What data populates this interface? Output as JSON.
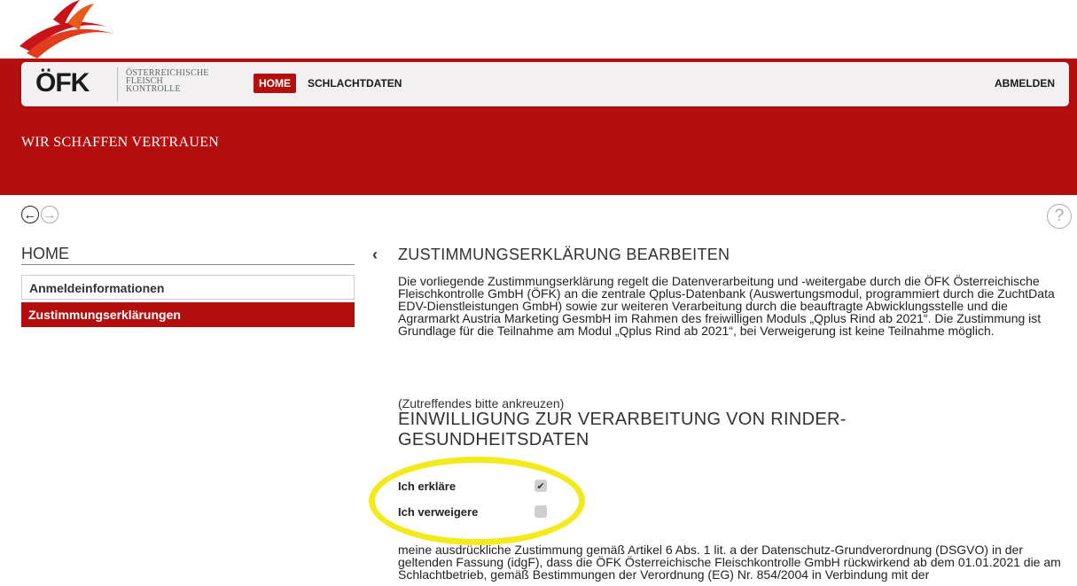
{
  "brand": {
    "logo_mark": "ÖFK",
    "subtitle_lines": [
      "ÖSTERREICHISCHE",
      "FLEISCH",
      "KONTROLLE"
    ],
    "slogan": "WIR SCHAFFEN VERTRAUEN",
    "color": "#b30f0f"
  },
  "nav": {
    "home": "HOME",
    "schlachtdaten": "SCHLACHTDATEN",
    "logout": "ABMELDEN"
  },
  "toolbar": {
    "back_icon": "arrow-left-icon",
    "forward_icon": "arrow-right-icon",
    "help_icon": "help-icon",
    "back_glyph": "←",
    "forward_glyph": "→",
    "help_glyph": "?"
  },
  "sidebar": {
    "title": "HOME",
    "items": [
      {
        "label": "Anmeldeinformationen",
        "active": false
      },
      {
        "label": "Zustimmungserklärungen",
        "active": true
      }
    ]
  },
  "main": {
    "collapse_glyph": "‹",
    "title": "ZUSTIMMUNGSERKLÄRUNG BEARBEITEN",
    "intro": "Die vorliegende Zustimmungserklärung regelt die Datenverarbeitung und -weitergabe durch die ÖFK Österreichische Fleischkontrolle GmbH (ÖFK) an die zentrale Qplus-Datenbank (Auswertungsmodul, programmiert durch die ZuchtData EDV-Dienstleistungen GmbH) sowie zur weiteren Verarbeitung durch die beauftragte Abwicklungsstelle und die Agrarmarkt Austria Marketing GesmbH im Rahmen des freiwilligen Moduls „Qplus Rind ab 2021“. Die Zustimmung ist Grundlage für die Teilnahme am Modul „Qplus Rind ab 2021“, bei Verweigerung ist keine Teilnahme möglich.",
    "hint": "(Zutreffendes bitte ankreuzen)",
    "section_title": "EINWILLIGUNG ZUR VERARBEITUNG VON RINDER-GESUNDHEITSDATEN",
    "options": [
      {
        "label": "Ich erkläre",
        "checked": true,
        "glyph": "✔"
      },
      {
        "label": "Ich verweigere",
        "checked": false,
        "glyph": ""
      }
    ],
    "consent_text": "meine ausdrückliche Zustimmung gemäß Artikel 6 Abs. 1 lit. a der Datenschutz-Grundverordnung (DSGVO) in der geltenden Fassung (idgF), dass die ÖFK Österreichische Fleischkontrolle GmbH rückwirkend ab dem 01.01.2021 die am Schlachtbetrieb, gemäß Bestimmungen der Verordnung (EG) Nr. 854/2004 in Verbindung mit der"
  },
  "annotation": {
    "ring_color": "#f2ea1d"
  }
}
